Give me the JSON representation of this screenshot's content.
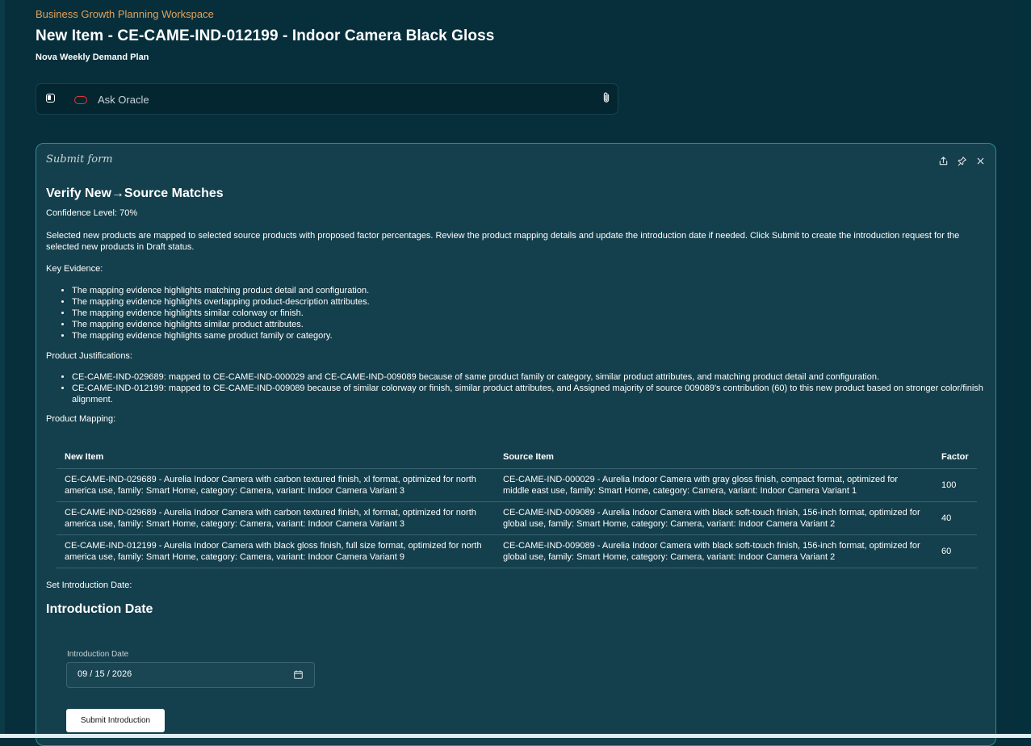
{
  "header": {
    "workspace": "Business Growth Planning Workspace",
    "title": "New Item - CE-CAME-IND-012199 - Indoor Camera Black Gloss",
    "plan": "Nova Weekly Demand Plan"
  },
  "ask": {
    "placeholder": "Ask Oracle",
    "icons": [
      "sidebar-toggle-icon",
      "oracle-logo-icon",
      "paperclip-icon"
    ]
  },
  "panel": {
    "title": "Submit form",
    "actions": [
      "share-icon",
      "pin-icon",
      "close-icon"
    ],
    "heading": "Verify New→Source Matches",
    "confidence": "Confidence Level: 70%",
    "description": "Selected new products are mapped to selected source products with proposed factor percentages. Review the product mapping details and update the introduction date if needed. Click Submit to create the introduction request for the selected new products in Draft status.",
    "key_evidence_label": "Key Evidence:",
    "key_evidence": [
      "The mapping evidence highlights matching product detail and configuration.",
      "The mapping evidence highlights overlapping product-description attributes.",
      "The mapping evidence highlights similar colorway or finish.",
      "The mapping evidence highlights similar product attributes.",
      "The mapping evidence highlights same product family or category."
    ],
    "justifications_label": "Product Justifications:",
    "justifications": [
      "CE-CAME-IND-029689: mapped to CE-CAME-IND-000029 and CE-CAME-IND-009089 because of same product family or category, similar product attributes, and matching product detail and configuration.",
      "CE-CAME-IND-012199: mapped to CE-CAME-IND-009089 because of similar colorway or finish, similar product attributes, and Assigned majority of source 009089's contribution (60) to this new product based on stronger color/finish alignment."
    ],
    "mapping_label": "Product Mapping:",
    "table": {
      "headers": [
        "New Item",
        "Source Item",
        "Factor"
      ],
      "rows": [
        [
          "CE-CAME-IND-029689 - Aurelia Indoor Camera with carbon textured finish, xl format, optimized for north america use, family: Smart Home, category: Camera, variant: Indoor Camera Variant 3",
          "CE-CAME-IND-000029 - Aurelia Indoor Camera with gray gloss finish, compact format, optimized for middle east use, family: Smart Home, category: Camera, variant: Indoor Camera Variant 1",
          "100"
        ],
        [
          "CE-CAME-IND-029689 - Aurelia Indoor Camera with carbon textured finish, xl format, optimized for north america use, family: Smart Home, category: Camera, variant: Indoor Camera Variant 3",
          "CE-CAME-IND-009089 - Aurelia Indoor Camera with black soft-touch finish, 156-inch format, optimized for global use, family: Smart Home, category: Camera, variant: Indoor Camera Variant 2",
          "40"
        ],
        [
          "CE-CAME-IND-012199 - Aurelia Indoor Camera with black gloss finish, full size format, optimized for north america use, family: Smart Home, category: Camera, variant: Indoor Camera Variant 9",
          "CE-CAME-IND-009089 - Aurelia Indoor Camera with black soft-touch finish, 156-inch format, optimized for global use, family: Smart Home, category: Camera, variant: Indoor Camera Variant 2",
          "60"
        ]
      ]
    },
    "set_intro_label": "Set Introduction Date:",
    "intro_heading": "Introduction Date",
    "date_field_label": "Introduction Date",
    "date_value": "09 / 15 / 2026",
    "submit_label": "Submit Introduction"
  }
}
